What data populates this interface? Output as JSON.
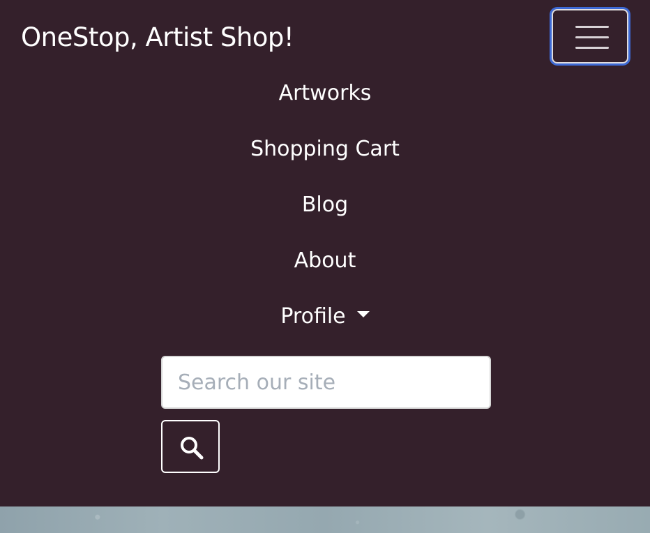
{
  "navbar": {
    "brand": "OneStop, Artist Shop!",
    "toggler_icon": "hamburger-icon",
    "links": [
      {
        "label": "Artworks"
      },
      {
        "label": "Shopping Cart"
      },
      {
        "label": "Blog"
      },
      {
        "label": "About"
      },
      {
        "label": "Profile"
      }
    ],
    "profile_caret_icon": "caret-down-icon",
    "background_color": "#34202b"
  },
  "search": {
    "placeholder": "Search our site",
    "value": "",
    "button_icon": "search-icon"
  },
  "colors": {
    "focus_ring": "#3d6ad6",
    "text": "#ffffff"
  }
}
